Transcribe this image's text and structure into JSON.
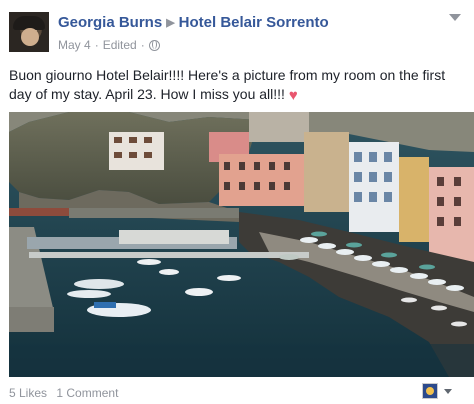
{
  "post": {
    "author": "Georgia Burns",
    "page": "Hotel Belair Sorrento",
    "date": "May 4",
    "edited": "Edited",
    "separator": "·",
    "text": "Buon giourno Hotel Belair!!!! Here's a picture from my room on the first day of my stay. April 23. How I miss you all!!!",
    "heart": "♥"
  },
  "footer": {
    "likes": "5 Likes",
    "comments": "1 Comment"
  },
  "icons": {
    "arrow": "▶"
  },
  "colors": {
    "link": "#365899",
    "meta": "#90949c",
    "heart": "#e9566e",
    "text": "#1d2129"
  }
}
